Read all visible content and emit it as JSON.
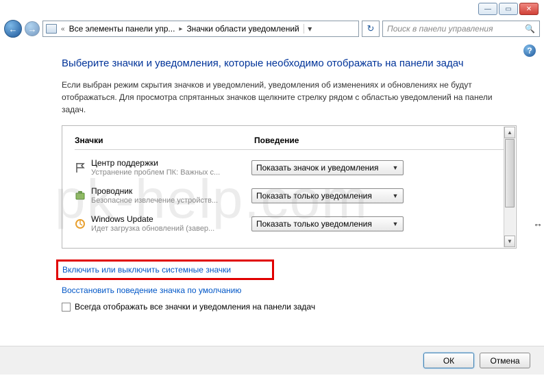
{
  "window_controls": {
    "min": "—",
    "max": "▭",
    "close": "✕"
  },
  "nav": {
    "back": "←",
    "fwd": "→"
  },
  "breadcrumb": {
    "seg1": "Все элементы панели упр...",
    "seg2": "Значки области уведомлений"
  },
  "search": {
    "placeholder": "Поиск в панели управления"
  },
  "help": "?",
  "heading": "Выберите значки и уведомления, которые необходимо отображать на панели задач",
  "description": "Если выбран режим скрытия значков и уведомлений, уведомления об изменениях и обновлениях не будут отображаться. Для просмотра спрятанных значков щелкните стрелку рядом с областью уведомлений на панели задач.",
  "columns": {
    "icons": "Значки",
    "behavior": "Поведение"
  },
  "rows": [
    {
      "name": "Центр поддержки",
      "sub": "Устранение проблем ПК: Важных с...",
      "behavior": "Показать значок и уведомления",
      "icon": "flag"
    },
    {
      "name": "Проводник",
      "sub": "Безопасное извлечение устройств...",
      "behavior": "Показать только уведомления",
      "icon": "explorer"
    },
    {
      "name": "Windows Update",
      "sub": "Идет загрузка обновлений (завер...",
      "behavior": "Показать только уведомления",
      "icon": "update"
    }
  ],
  "link1": "Включить или выключить системные значки",
  "link2": "Восстановить поведение значка по умолчанию",
  "checkbox_label": "Всегда отображать все значки и уведомления на панели задач",
  "buttons": {
    "ok": "ОК",
    "cancel": "Отмена"
  },
  "watermark": "pk-help.com"
}
